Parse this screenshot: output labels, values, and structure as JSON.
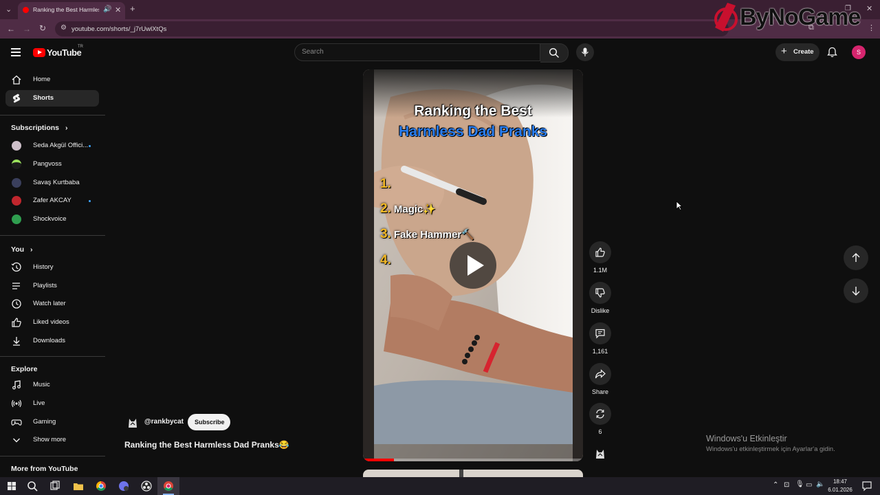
{
  "browser": {
    "tab_title": "Ranking the Best Harmless",
    "url": "youtube.com/shorts/_j7rUwlXtQs",
    "watermark": "ByNoGame"
  },
  "header": {
    "logo_text": "YouTube",
    "region": "TR",
    "search_placeholder": "Search",
    "create_label": "Create",
    "avatar_letter": "S"
  },
  "sidebar": {
    "main": [
      {
        "label": "Home"
      },
      {
        "label": "Shorts"
      }
    ],
    "subscriptions_title": "Subscriptions",
    "subscriptions": [
      {
        "label": "Seda Akgül Offici..."
      },
      {
        "label": "Pangvoss"
      },
      {
        "label": "Savaş Kurtbaba"
      },
      {
        "label": "Zafer AKCAY"
      },
      {
        "label": "Shockvoice"
      }
    ],
    "you_title": "You",
    "you": [
      {
        "label": "History"
      },
      {
        "label": "Playlists"
      },
      {
        "label": "Watch later"
      },
      {
        "label": "Liked videos"
      },
      {
        "label": "Downloads"
      }
    ],
    "explore_title": "Explore",
    "explore": [
      {
        "label": "Music"
      },
      {
        "label": "Live"
      },
      {
        "label": "Gaming"
      },
      {
        "label": "Show more"
      }
    ],
    "more_title": "More from YouTube"
  },
  "video": {
    "overlay_title_1": "Ranking the Best",
    "overlay_title_2": "Harmless Dad Pranks",
    "ranks": [
      {
        "num": "1.",
        "text": ""
      },
      {
        "num": "2.",
        "text": "Magic✨"
      },
      {
        "num": "3.",
        "text": "Fake Hammer🔨"
      },
      {
        "num": "4.",
        "text": ""
      }
    ],
    "channel": "@rankbycat",
    "subscribe_label": "Subscribe",
    "title": "Ranking the Best Harmless Dad Pranks😂",
    "progress": 0.14
  },
  "actions": {
    "likes": "1.1M",
    "dislike_label": "Dislike",
    "comments": "1,161",
    "share_label": "Share",
    "remix": "6"
  },
  "windows": {
    "activate_title": "Windows'u Etkinleştir",
    "activate_sub": "Windows'u etkinleştirmek için Ayarlar'a gidin.",
    "time": "18:47",
    "date": "6.01.2026"
  }
}
